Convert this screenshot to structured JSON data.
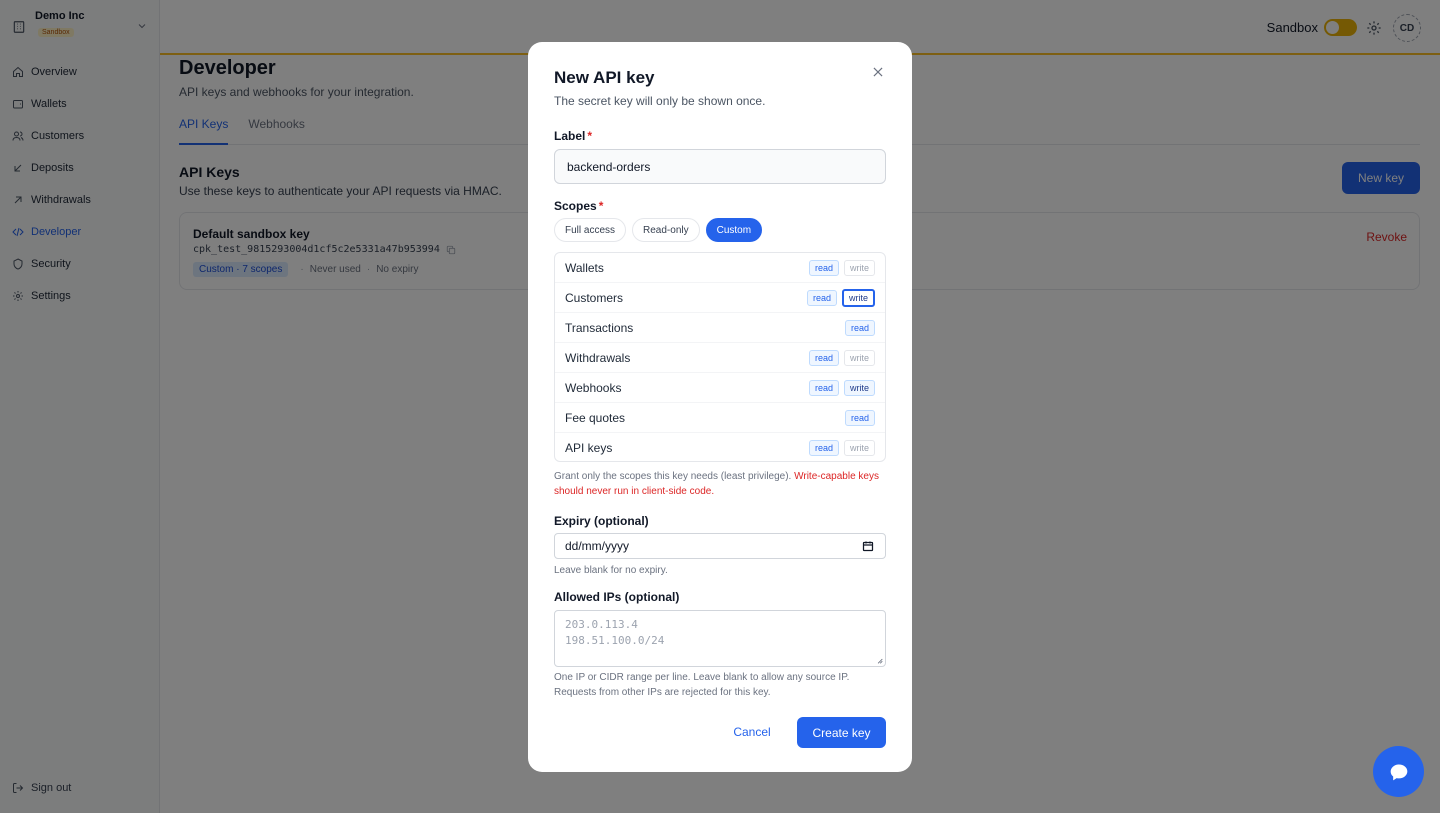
{
  "org": {
    "name": "Demo Inc",
    "badge": "Sandbox"
  },
  "sidebar": {
    "items": [
      {
        "label": "Overview",
        "icon": "home-icon"
      },
      {
        "label": "Wallets",
        "icon": "wallet-icon"
      },
      {
        "label": "Customers",
        "icon": "users-icon"
      },
      {
        "label": "Deposits",
        "icon": "arrow-down-left-icon"
      },
      {
        "label": "Withdrawals",
        "icon": "arrow-up-right-icon"
      },
      {
        "label": "Developer",
        "icon": "code-icon",
        "active": true
      },
      {
        "label": "Security",
        "icon": "shield-icon"
      },
      {
        "label": "Settings",
        "icon": "gear-icon"
      }
    ],
    "signout": "Sign out"
  },
  "topbar": {
    "sandbox_label": "Sandbox",
    "avatar": "CD"
  },
  "page": {
    "title": "Developer",
    "subtitle": "API keys and webhooks for your integration.",
    "tabs": [
      "API Keys",
      "Webhooks"
    ],
    "section_title": "API Keys",
    "section_subtitle": "Use these keys to authenticate your API requests via HMAC.",
    "new_key_label": "New key",
    "key": {
      "name": "Default sandbox key",
      "id": "cpk_test_9815293004d1cf5c2e5331a47b953994",
      "scope_badge": "Custom · 7 scopes",
      "usage": "Never used",
      "expiry": "No expiry",
      "revoke": "Revoke"
    }
  },
  "modal": {
    "title": "New API key",
    "subtitle": "The secret key will only be shown once.",
    "label_field": "Label",
    "label_value": "backend-orders",
    "scopes_field": "Scopes",
    "scope_tabs": [
      "Full access",
      "Read-only",
      "Custom"
    ],
    "scopes": [
      {
        "name": "Wallets",
        "read": "read",
        "write": "write"
      },
      {
        "name": "Customers",
        "read": "read",
        "write": "write"
      },
      {
        "name": "Transactions",
        "read": "read"
      },
      {
        "name": "Withdrawals",
        "read": "read",
        "write": "write"
      },
      {
        "name": "Webhooks",
        "read": "read",
        "write": "write"
      },
      {
        "name": "Fee quotes",
        "read": "read"
      },
      {
        "name": "API keys",
        "read": "read",
        "write": "write"
      }
    ],
    "scope_hint": "Grant only the scopes this key needs (least privilege).",
    "scope_warn": "Write-capable keys should never run in client-side code.",
    "expiry_field": "Expiry (optional)",
    "expiry_placeholder": "dd/mm/yyyy",
    "expiry_hint": "Leave blank for no expiry.",
    "ips_field": "Allowed IPs (optional)",
    "ips_placeholder_1": "203.0.113.4",
    "ips_placeholder_2": "198.51.100.0/24",
    "ips_hint_1": "One IP or CIDR range per line. Leave blank to allow any source IP.",
    "ips_hint_2": "Requests from other IPs are rejected for this key.",
    "cancel": "Cancel",
    "create": "Create key"
  },
  "colors": {
    "accent": "#2563eb",
    "danger": "#dc2626",
    "sandbox": "#eab308"
  }
}
